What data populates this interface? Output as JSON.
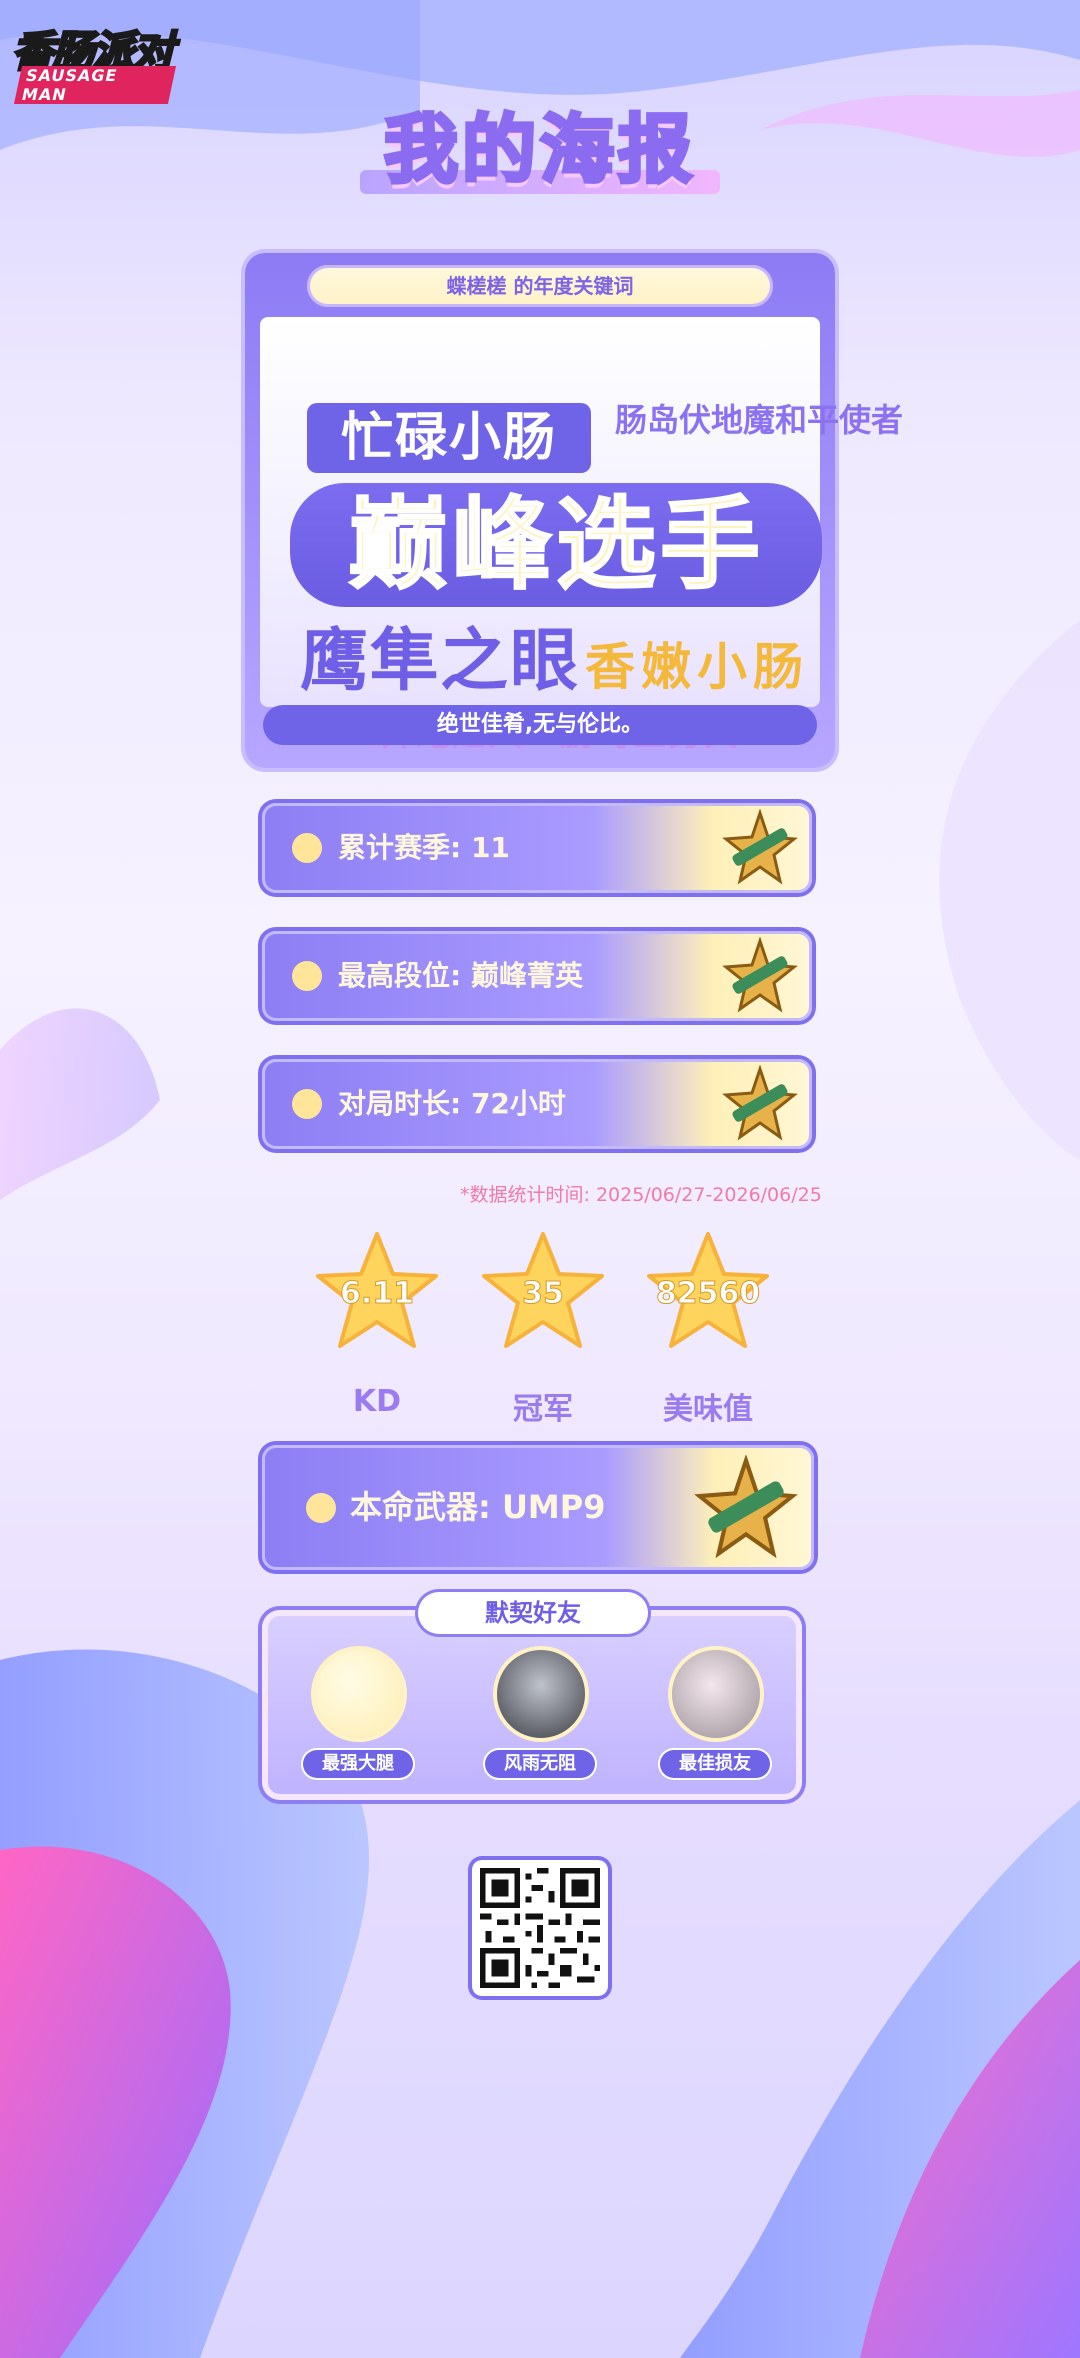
{
  "brand": {
    "logo_top": "香肠派对",
    "logo_bottom": "SAUSAGE MAN"
  },
  "page_title": "我的海报",
  "keywords_card": {
    "header": "蝶槎槎 的年度关键词",
    "keywords": [
      "忙碌小肠",
      "肠岛伏地魔和平使者",
      "巅峰选手",
      "鹰隼之眼",
      "香嫩小肠",
      "奔跑达人",
      "肠岛医务兵"
    ],
    "footer": "绝世佳肴,无与伦比。"
  },
  "stats": [
    {
      "label": "累计赛季: 11",
      "icon": "weapon-badge-icon"
    },
    {
      "label": "最高段位: 巅峰菁英",
      "icon": "weapon-badge-icon"
    },
    {
      "label": "对局时长: 72小时",
      "icon": "weapon-badge-icon"
    }
  ],
  "date_note": "*数据统计时间: 2025/06/27-2026/06/25",
  "star_stats": [
    {
      "value": "6.11",
      "label": "KD"
    },
    {
      "value": "35",
      "label": "冠军"
    },
    {
      "value": "82560",
      "label": "美味值"
    }
  ],
  "weapon": {
    "label": "本命武器: UMP9",
    "icon": "weapon-badge-icon"
  },
  "friends": {
    "title": "默契好友",
    "items": [
      {
        "name": "最强大腿"
      },
      {
        "name": "风雨无阻"
      },
      {
        "name": "最佳损友"
      }
    ]
  },
  "colors": {
    "primary": "#6f63e8",
    "accent_yellow": "#ffe59a",
    "pink": "#f07aa8"
  }
}
